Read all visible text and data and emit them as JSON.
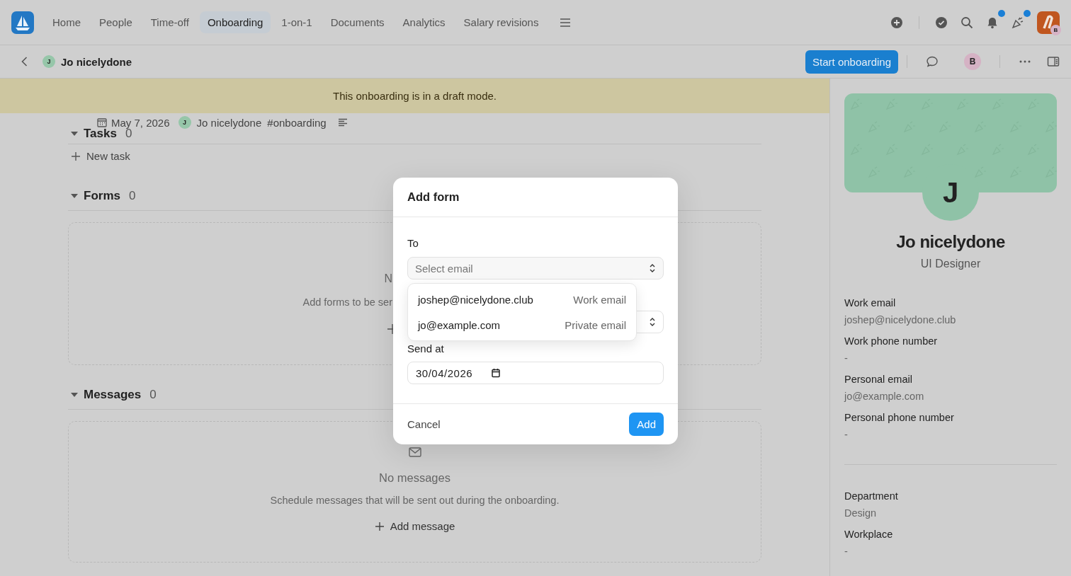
{
  "nav": {
    "tabs": [
      {
        "label": "Home",
        "selected": false
      },
      {
        "label": "People",
        "selected": false
      },
      {
        "label": "Time-off",
        "selected": false
      },
      {
        "label": "Onboarding",
        "selected": true
      },
      {
        "label": "1-on-1",
        "selected": false
      },
      {
        "label": "Documents",
        "selected": false
      },
      {
        "label": "Analytics",
        "selected": false
      },
      {
        "label": "Salary revisions",
        "selected": false
      }
    ],
    "tools": [
      {
        "kind": "add",
        "badge": false
      },
      {
        "kind": "done",
        "badge": false
      },
      {
        "kind": "search",
        "badge": false
      },
      {
        "kind": "bell",
        "badge": true
      },
      {
        "kind": "party",
        "badge": true
      }
    ],
    "account_initial": "B"
  },
  "header": {
    "person_initial": "J",
    "person_name": "Jo nicelydone",
    "start_button": "Start onboarding",
    "viewer_initial": "B"
  },
  "banner": "This onboarding is in a draft mode.",
  "meta": {
    "date": "May 7, 2026",
    "person_initial": "J",
    "person_name": "Jo nicelydone",
    "tag": "#onboarding"
  },
  "tasks": {
    "title": "Tasks",
    "count": "0",
    "new_task": "New task"
  },
  "forms": {
    "title": "Forms",
    "count": "0",
    "empty_title": "N",
    "empty_text": "Add forms to be ser"
  },
  "messages": {
    "title": "Messages",
    "count": "0",
    "empty_title": "No messages",
    "empty_text": "Schedule messages that will be sent out during the onboarding.",
    "action": "Add message"
  },
  "modal": {
    "title": "Add form",
    "to_label": "To",
    "to_placeholder": "Select email",
    "options": [
      {
        "email": "joshep@nicelydone.club",
        "type": "Work email"
      },
      {
        "email": "jo@example.com",
        "type": "Private email"
      }
    ],
    "send_label": "Send at",
    "send_value": "30/04/2026",
    "cancel": "Cancel",
    "add": "Add"
  },
  "profile": {
    "initial": "J",
    "name": "Jo nicelydone",
    "role": "UI Designer",
    "contact": [
      {
        "label": "Work email",
        "value": "joshep@nicelydone.club"
      },
      {
        "label": "Work phone number",
        "value": "-"
      },
      {
        "label": "Personal email",
        "value": "jo@example.com"
      },
      {
        "label": "Personal phone number",
        "value": "-"
      }
    ],
    "work": [
      {
        "label": "Department",
        "value": "Design"
      },
      {
        "label": "Workplace",
        "value": "-"
      }
    ]
  }
}
